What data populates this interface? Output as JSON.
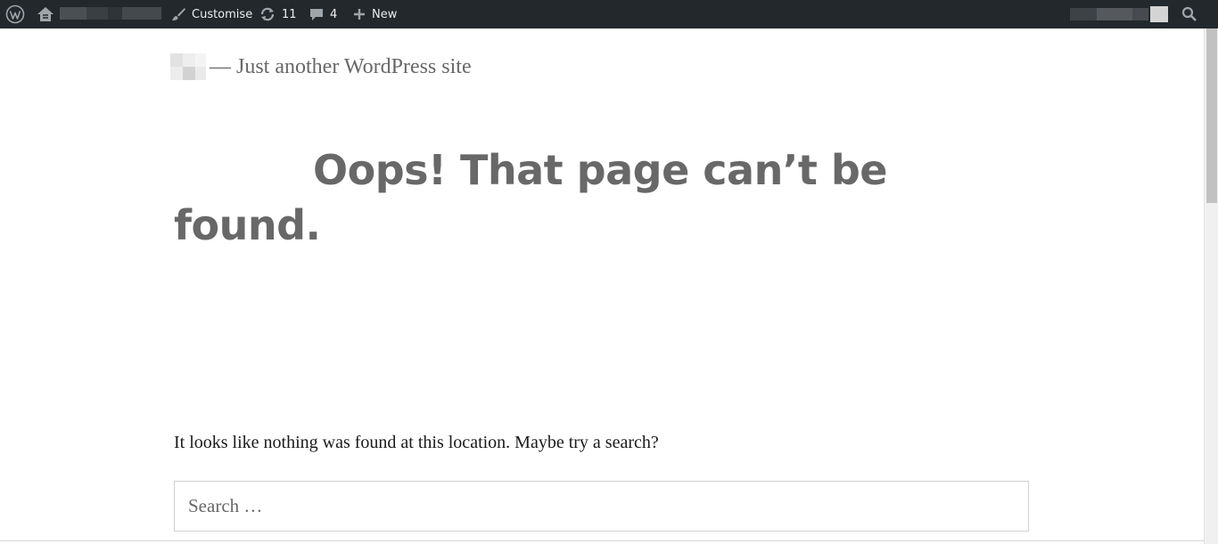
{
  "admin_bar": {
    "customise_label": "Customise",
    "updates_count": "11",
    "comments_count": "4",
    "new_label": "New",
    "icons": [
      "wordpress-logo-icon",
      "site-home-icon",
      "paintbrush-icon",
      "refresh-icon",
      "comment-icon",
      "plus-icon",
      "search-icon"
    ]
  },
  "site": {
    "tagline": "— Just another WordPress site"
  },
  "main": {
    "title": "Oops! That page can’t be found.",
    "message": "It looks like nothing was found at this location. Maybe try a search?"
  },
  "search": {
    "placeholder": "Search …"
  },
  "colors": {
    "admin_bar_bg": "#23282d",
    "heading": "#686868",
    "body_text": "#1a1a1a",
    "border": "#d1d1d1"
  }
}
